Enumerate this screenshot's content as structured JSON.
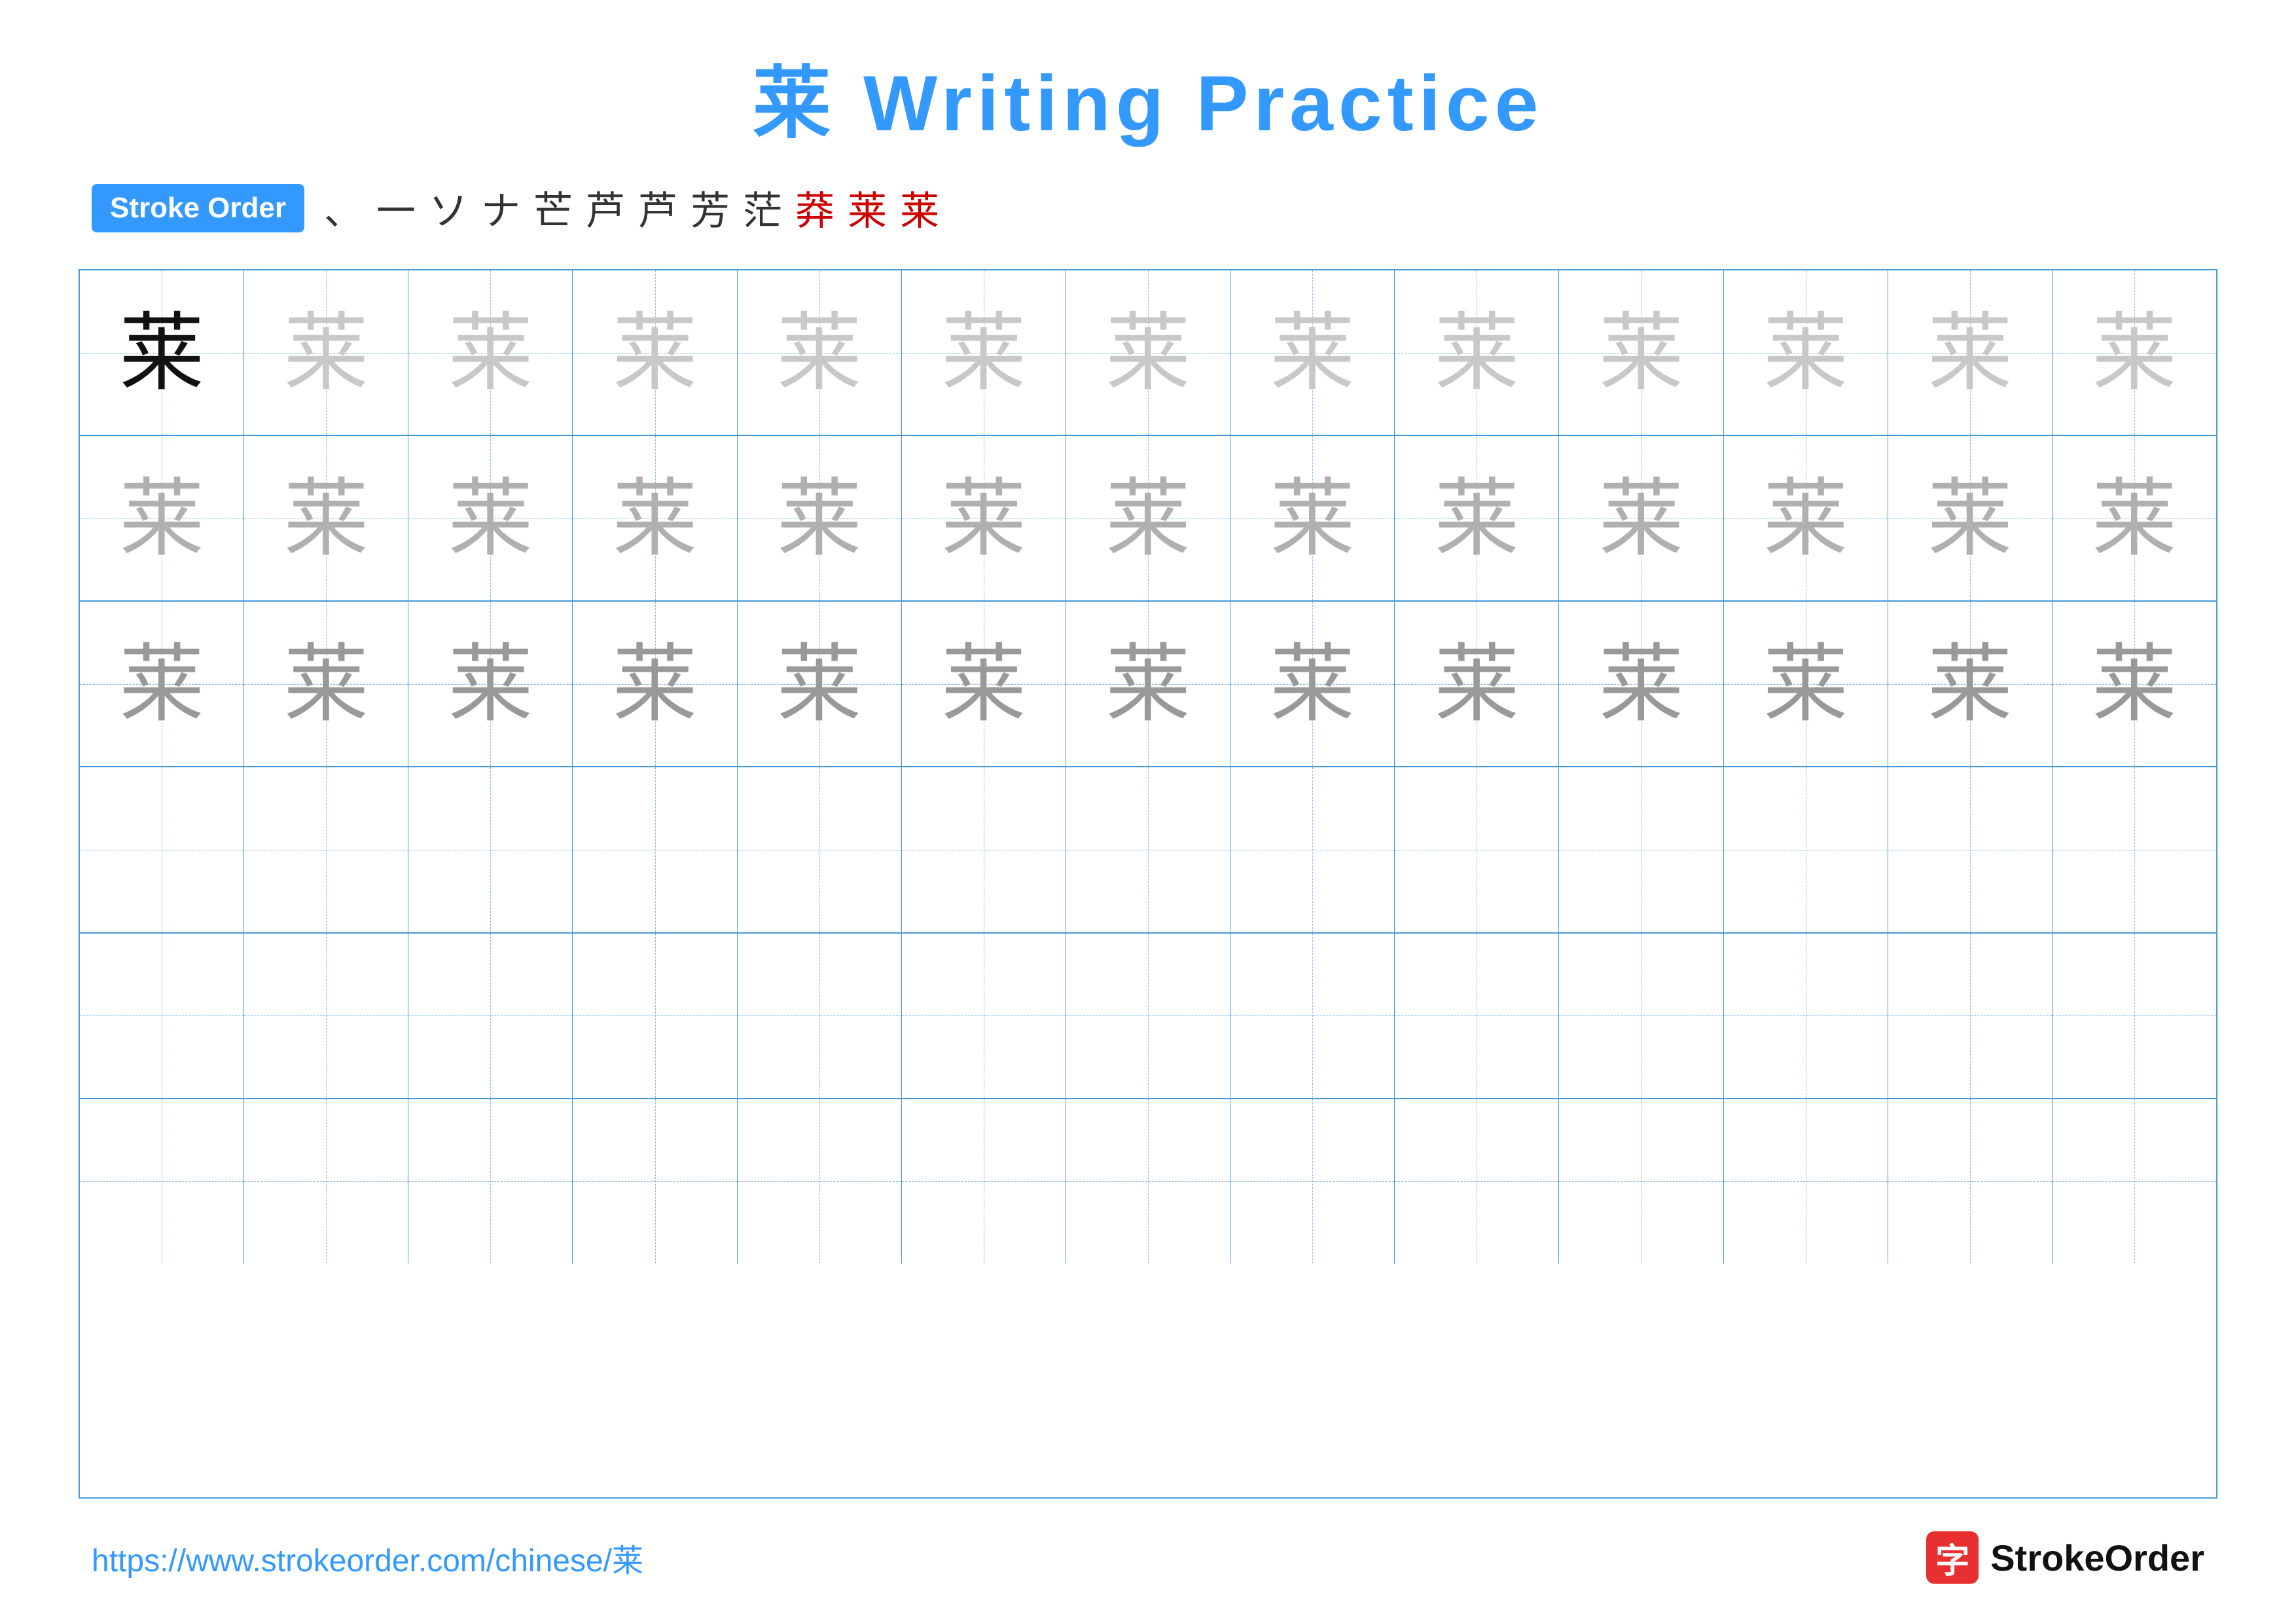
{
  "title": {
    "character": "莱",
    "text": "莱 Writing Practice",
    "color": "#3399ff"
  },
  "stroke_order": {
    "badge_label": "Stroke Order",
    "strokes": [
      "、",
      "一",
      "ソ",
      "ナ",
      "芒",
      "芦",
      "芦",
      "芳",
      "茫",
      "莽",
      "莱",
      "莱"
    ]
  },
  "grid": {
    "rows": 6,
    "cols": 13,
    "character": "莱",
    "row_data": [
      {
        "type": "dark",
        "shade": "black"
      },
      {
        "type": "medium",
        "shade": "light1"
      },
      {
        "type": "medium",
        "shade": "light2"
      },
      {
        "type": "empty"
      },
      {
        "type": "empty"
      },
      {
        "type": "empty"
      }
    ]
  },
  "footer": {
    "url": "https://www.strokeorder.com/chinese/莱",
    "logo_text": "StrokeOrder",
    "logo_icon": "字"
  }
}
